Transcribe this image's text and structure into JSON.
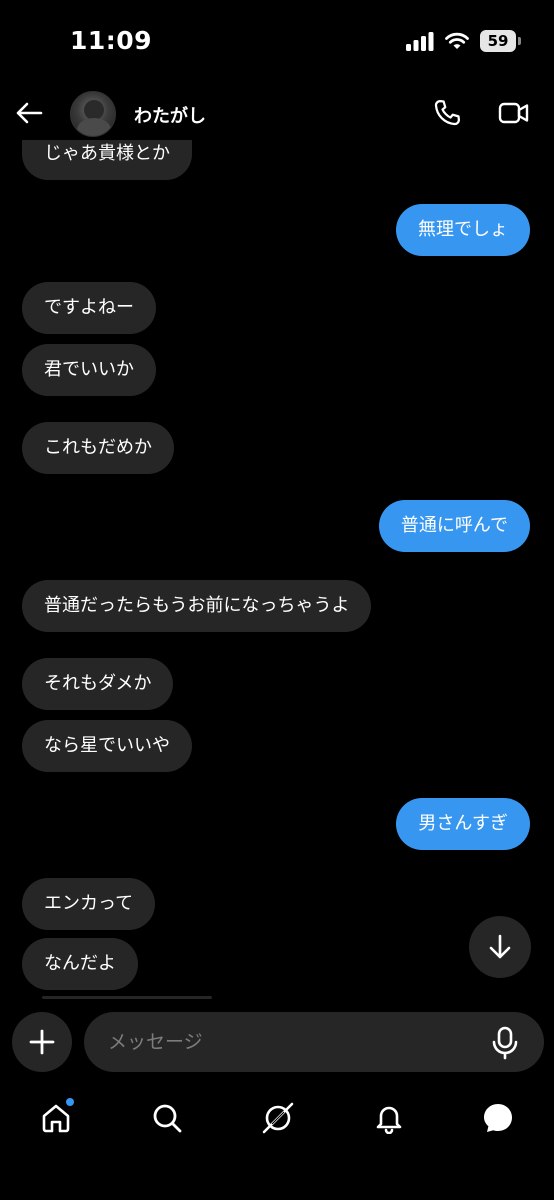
{
  "status_bar": {
    "time": "11:09",
    "battery": "59"
  },
  "header": {
    "contact_name": "わたがし"
  },
  "messages": [
    {
      "from": "them",
      "text": "じゃあ貴様とか"
    },
    {
      "from": "me",
      "text": "無理でしょ"
    },
    {
      "from": "them",
      "text": "ですよねー"
    },
    {
      "from": "them",
      "text": "君でいいか"
    },
    {
      "from": "them",
      "text": "これもだめか"
    },
    {
      "from": "me",
      "text": "普通に呼んで"
    },
    {
      "from": "them",
      "text": "普通だったらもうお前になっちゃうよ"
    },
    {
      "from": "them",
      "text": "それもダメか"
    },
    {
      "from": "them",
      "text": "なら星でいいや"
    },
    {
      "from": "me",
      "text": "男さんすぎ"
    },
    {
      "from": "them",
      "text": "エンカって"
    },
    {
      "from": "them",
      "text": "なんだよ"
    }
  ],
  "composer": {
    "placeholder": "メッセージ"
  },
  "icons": {
    "back": "arrow-left-icon",
    "call": "phone-icon",
    "video": "video-camera-icon",
    "scroll_down": "arrow-down-icon",
    "add": "plus-icon",
    "mic": "microphone-icon",
    "nav": [
      "home-icon",
      "search-icon",
      "explore-icon",
      "bell-icon",
      "messages-icon"
    ]
  },
  "colors": {
    "outgoing_bubble": "#3797f0",
    "incoming_bubble": "#262626",
    "background": "#000000",
    "notification_dot": "#3797f0"
  }
}
